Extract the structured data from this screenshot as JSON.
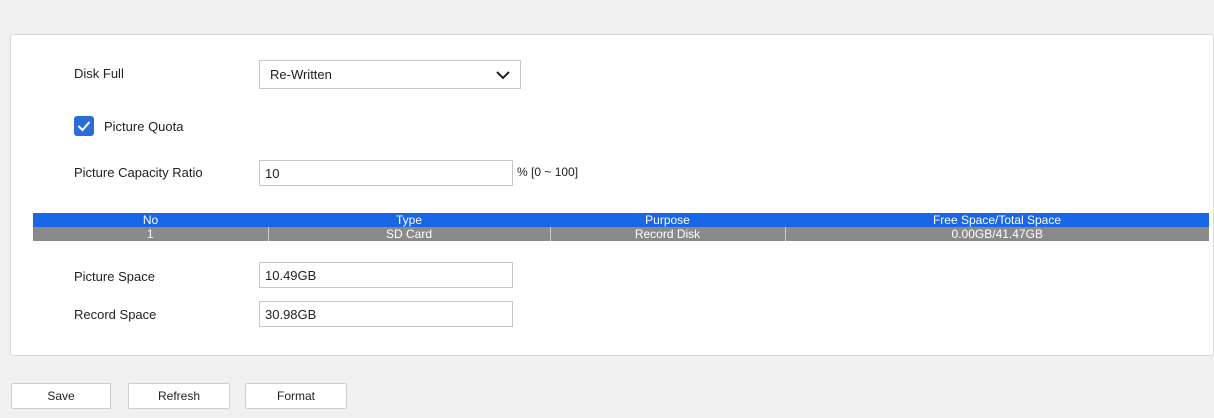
{
  "disk_full": {
    "label": "Disk Full",
    "selected_value": "Re-Written"
  },
  "picture_quota": {
    "label": "Picture Quota",
    "checked": true
  },
  "picture_capacity_ratio": {
    "label": "Picture Capacity Ratio",
    "value": "10",
    "range_hint": "% [0 ~ 100]"
  },
  "disk_table": {
    "headers": [
      "No",
      "Type",
      "Purpose",
      "Free Space/Total Space"
    ],
    "rows": [
      [
        "1",
        "SD Card",
        "Record Disk",
        "0.00GB/41.47GB"
      ]
    ]
  },
  "picture_space": {
    "label": "Picture Space",
    "value": "10.49GB"
  },
  "record_space": {
    "label": "Record Space",
    "value": "30.98GB"
  },
  "buttons": {
    "save": "Save",
    "refresh": "Refresh",
    "format": "Format"
  },
  "colors": {
    "accent": "#2a6dd8",
    "table_header": "#1a66e8",
    "table_row": "#8a8a8a"
  }
}
